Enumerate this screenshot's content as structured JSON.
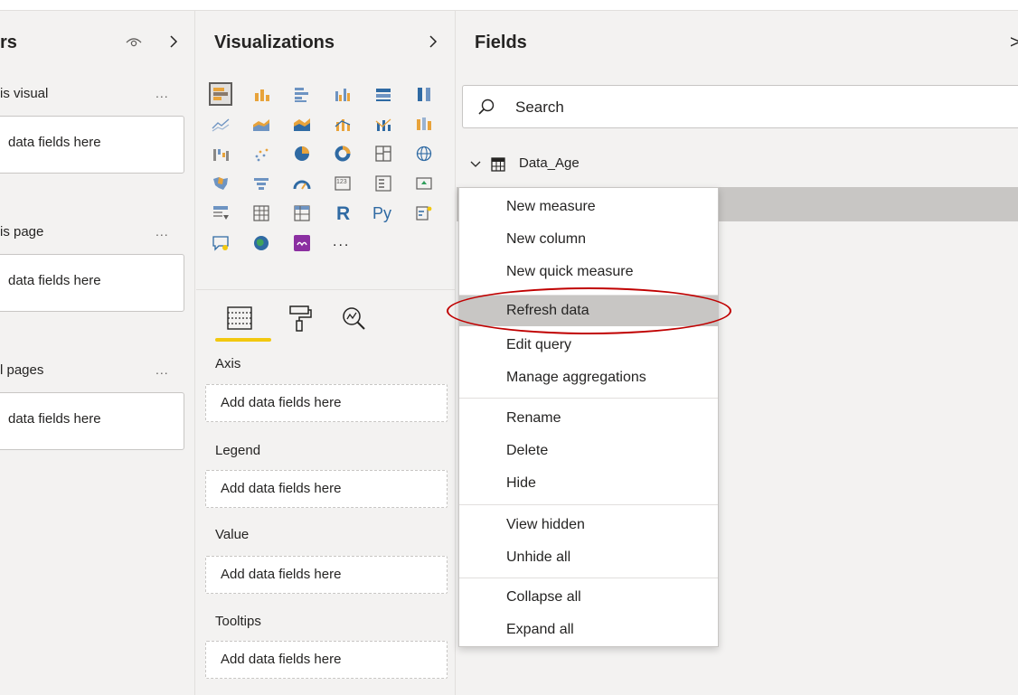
{
  "filters": {
    "title": "rs",
    "sections": [
      {
        "label": "is visual",
        "dots": "...",
        "placeholder": "data fields here"
      },
      {
        "label": "is page",
        "dots": "...",
        "placeholder": "data fields here"
      },
      {
        "label": "l pages",
        "dots": "...",
        "placeholder": "data fields here"
      }
    ]
  },
  "visualizations": {
    "title": "Visualizations",
    "more": "...",
    "wells": [
      {
        "label": "Axis",
        "placeholder": "Add data fields here"
      },
      {
        "label": "Legend",
        "placeholder": "Add data fields here"
      },
      {
        "label": "Value",
        "placeholder": "Add data fields here"
      },
      {
        "label": "Tooltips",
        "placeholder": "Add data fields here"
      }
    ],
    "r_label": "R",
    "py_label": "Py",
    "card_label": "123"
  },
  "fields": {
    "title": "Fields",
    "search_placeholder": "Search",
    "table_name": "Data_Age"
  },
  "context_menu": {
    "items": [
      "New measure",
      "New column",
      "New quick measure",
      "Refresh data",
      "Edit query",
      "Manage aggregations",
      "Rename",
      "Delete",
      "Hide",
      "View hidden",
      "Unhide all",
      "Collapse all",
      "Expand all"
    ],
    "highlighted": "Refresh data"
  },
  "colors": {
    "accent_yellow": "#f2c80f",
    "callout_red": "#c00000",
    "highlight_gray": "#c8c6c4",
    "pane_bg": "#f3f2f1"
  }
}
